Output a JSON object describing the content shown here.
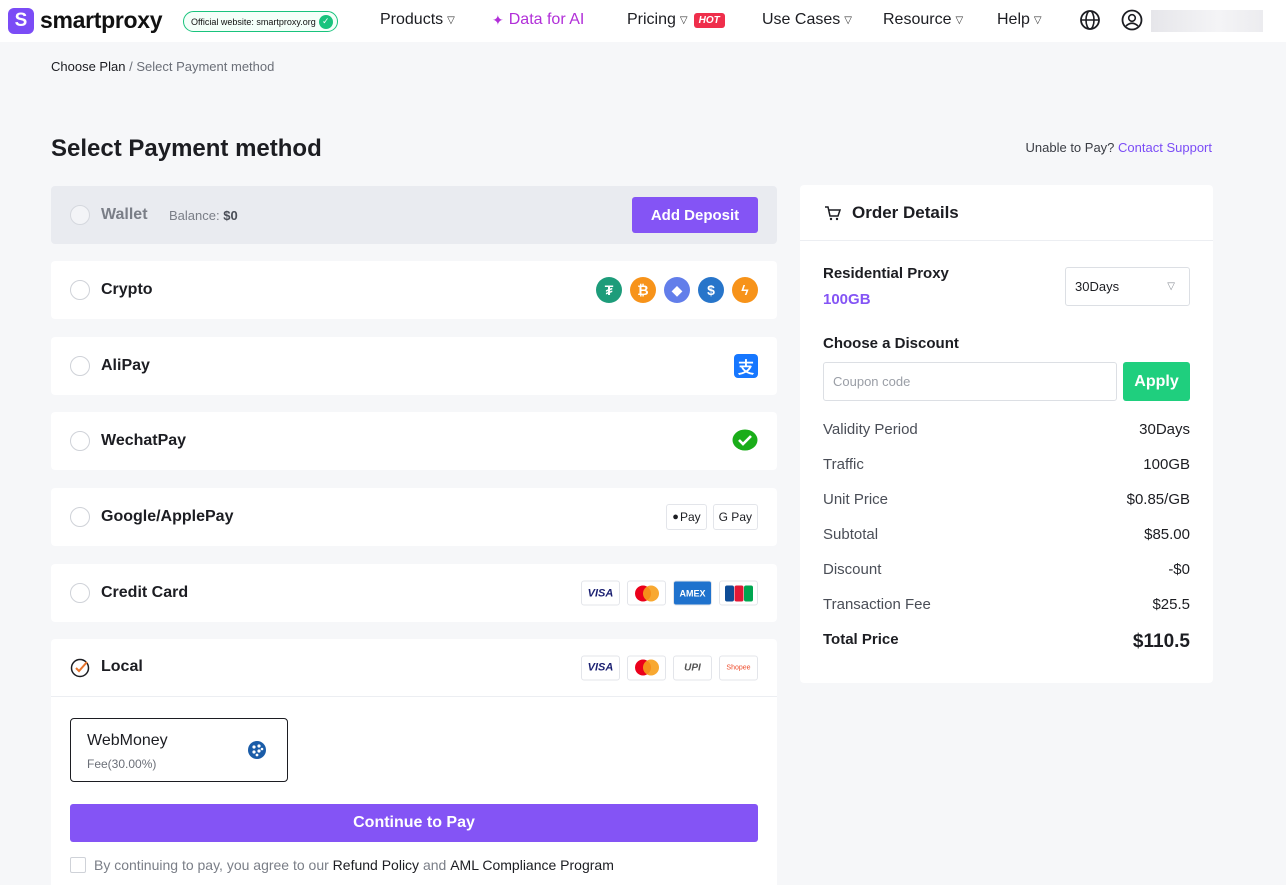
{
  "nav": {
    "brand": "smartproxy",
    "official_badge": "Official website: smartproxy.org",
    "products": "Products",
    "data_for_ai": "Data for AI",
    "pricing": "Pricing",
    "hot_badge": "HOT",
    "use_cases": "Use Cases",
    "resource": "Resource",
    "help": "Help"
  },
  "breadcrumb": {
    "step1": "Choose Plan",
    "separator": "/",
    "step2": "Select Payment method"
  },
  "page": {
    "title": "Select Payment method",
    "unable_text": "Unable to Pay?",
    "contact_link": "Contact Support"
  },
  "payment": {
    "wallet": {
      "label": "Wallet",
      "balance_label": "Balance:",
      "balance_value": "$0",
      "deposit_button": "Add Deposit"
    },
    "methods": [
      {
        "label": "Crypto"
      },
      {
        "label": "AliPay"
      },
      {
        "label": "WechatPay"
      },
      {
        "label": "Google/ApplePay"
      },
      {
        "label": "Credit Card"
      }
    ],
    "local": {
      "label": "Local",
      "selected": true,
      "option_name": "WebMoney",
      "option_fee": "Fee(30.00%)"
    },
    "applepay_badge": "Pay",
    "gpay_badge": "G Pay",
    "visa": "VISA",
    "upi": "UPI",
    "shopee": "Shopee",
    "continue_button": "Continue to Pay",
    "agree_text": "By continuing to pay, you agree to our",
    "refund_policy": "Refund Policy",
    "and": "and",
    "aml": "AML Compliance Program"
  },
  "order": {
    "title": "Order Details",
    "product": "Residential Proxy",
    "amount": "100GB",
    "period_select": "30Days",
    "discount_label": "Choose a Discount",
    "coupon_placeholder": "Coupon code",
    "apply_button": "Apply",
    "lines": [
      {
        "key": "Validity Period",
        "value": "30Days"
      },
      {
        "key": "Traffic",
        "value": "100GB"
      },
      {
        "key": "Unit Price",
        "value": "$0.85/GB"
      },
      {
        "key": "Subtotal",
        "value": "$85.00"
      },
      {
        "key": "Discount",
        "value": "-$0"
      },
      {
        "key": "Transaction Fee",
        "value": "$25.5"
      }
    ],
    "total_label": "Total Price",
    "total_value": "$110.5"
  },
  "colors": {
    "accent": "#8454f5",
    "apply": "#1fcf7e",
    "hot": "#ef2e4b",
    "ai": "#b12fd8"
  }
}
